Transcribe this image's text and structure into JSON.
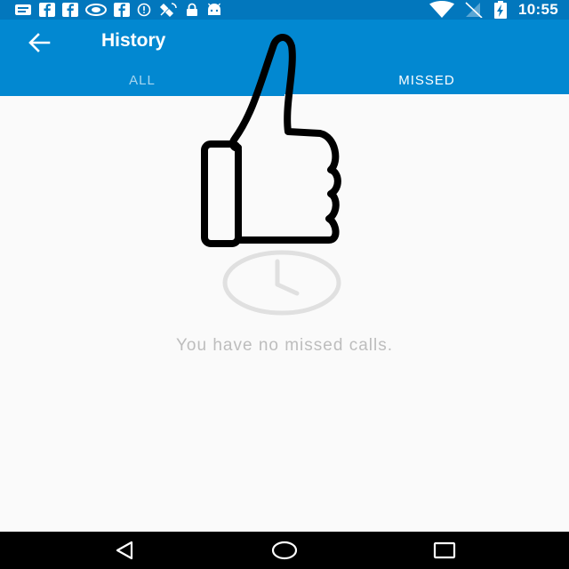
{
  "status_bar": {
    "time": "10:55",
    "notification_icons": [
      "messages-icon",
      "facebook-icon",
      "facebook-icon",
      "nvidia-icon",
      "facebook-icon",
      "info-icon",
      "satellite-icon",
      "lock-icon",
      "android-icon"
    ],
    "system_icons": [
      "wifi-icon",
      "no-sim-icon",
      "battery-charging-icon"
    ]
  },
  "app_bar": {
    "title": "History",
    "back_icon": "arrow-back-icon",
    "tabs": [
      {
        "label": "ALL",
        "active": false
      },
      {
        "label": "MISSED",
        "active": true
      }
    ]
  },
  "empty_state": {
    "icon": "clock-icon",
    "message": "You have no missed calls."
  },
  "overlay": {
    "icon": "thumbs-up-icon"
  },
  "nav_bar": {
    "buttons": [
      "back-triangle-icon",
      "home-circle-icon",
      "recents-square-icon"
    ]
  },
  "colors": {
    "status_bar": "#0277bd",
    "app_bar": "#0288d1",
    "background": "#fafafa",
    "empty_text": "#bdbdbd",
    "empty_icon": "#e0e0e0"
  }
}
